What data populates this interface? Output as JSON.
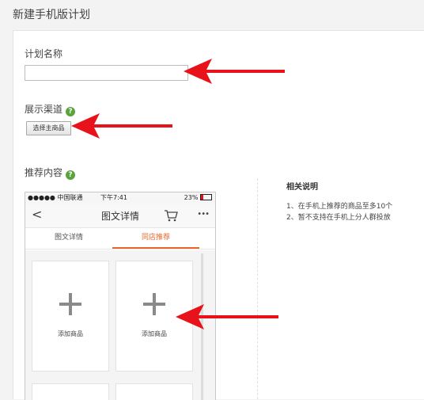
{
  "page": {
    "title": "新建手机版计划"
  },
  "form": {
    "plan_name_label": "计划名称",
    "plan_name_value": "",
    "channel_label": "展示渠道",
    "select_button": "选择主商品",
    "content_label": "推荐内容",
    "help_glyph": "?"
  },
  "notes": {
    "title": "相关说明",
    "items": [
      "1、在手机上推荐的商品至多10个",
      "2、暂不支持在手机上分人群投放"
    ]
  },
  "phone": {
    "status": {
      "left": "●●●●● 中国联通",
      "time": "下午7:41",
      "battery": "23%"
    },
    "nav": {
      "back": "<",
      "title": "图文详情",
      "more": "•••"
    },
    "tabs": [
      {
        "label": "图文详情"
      },
      {
        "label": "同店推荐"
      }
    ],
    "cards": [
      {
        "label": "添加商品"
      },
      {
        "label": "添加商品"
      }
    ]
  },
  "colors": {
    "arrow": "#e8121b",
    "accent_tab": "#e8662a",
    "help_icon": "#5aa33e"
  }
}
